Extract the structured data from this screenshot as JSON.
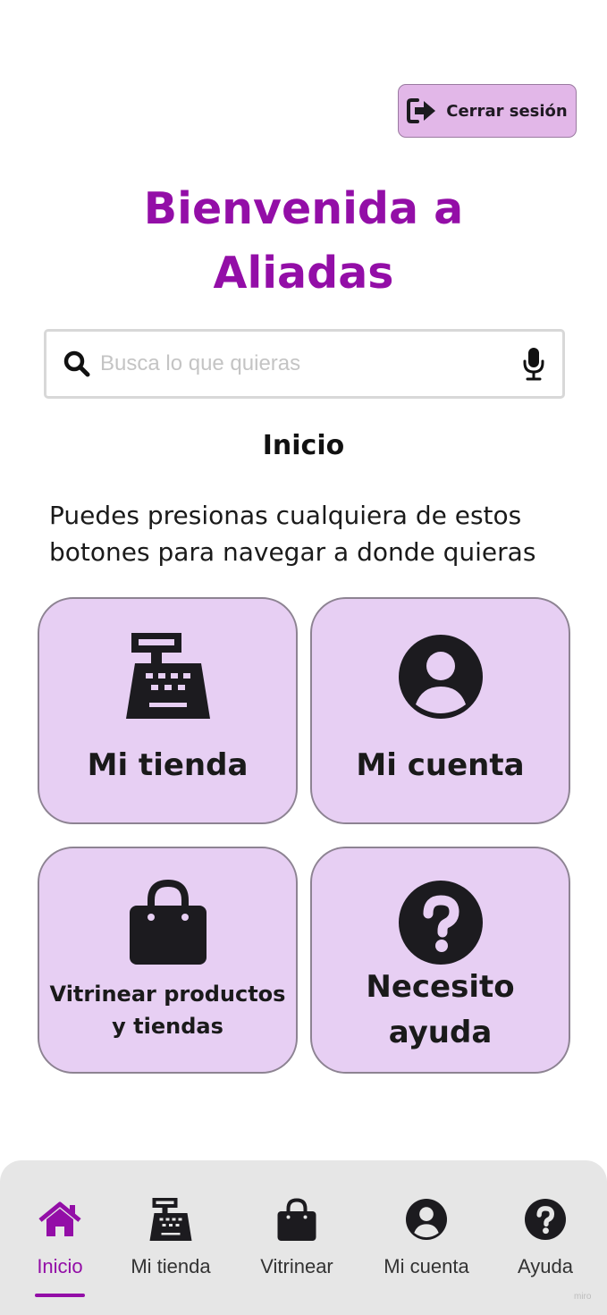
{
  "header": {
    "logout_label": "Cerrar sesión"
  },
  "main": {
    "title_line1": "Bienvenida a",
    "title_line2": "Aliadas",
    "search": {
      "placeholder": "Busca lo que quieras",
      "value": ""
    },
    "section_title": "Inicio",
    "intro_line1": "Puedes presionas cualquiera de estos",
    "intro_line2": "botones para navegar a donde quieras",
    "cards": [
      {
        "label": "Mi tienda",
        "icon": "cash-register-icon"
      },
      {
        "label": "Mi cuenta",
        "icon": "user-circle-icon"
      },
      {
        "label_line1": "Vitrinear productos",
        "label_line2": "y tiendas",
        "icon": "shopping-bag-icon"
      },
      {
        "label_line1": "Necesito",
        "label_line2": "ayuda",
        "icon": "question-circle-icon"
      }
    ]
  },
  "bottom_nav": {
    "items": [
      {
        "label": "Inicio",
        "icon": "home-icon",
        "active": true
      },
      {
        "label": "Mi tienda",
        "icon": "cash-register-icon",
        "active": false
      },
      {
        "label": "Vitrinear",
        "icon": "shopping-bag-icon",
        "active": false
      },
      {
        "label": "Mi cuenta",
        "icon": "user-circle-icon",
        "active": false
      },
      {
        "label": "Ayuda",
        "icon": "question-circle-icon",
        "active": false
      }
    ]
  },
  "watermark": "miro",
  "colors": {
    "accent": "#930ea7",
    "card_bg": "#e7cff3",
    "logout_bg": "#e2b7e8",
    "nav_bg": "#e6e6e6"
  }
}
